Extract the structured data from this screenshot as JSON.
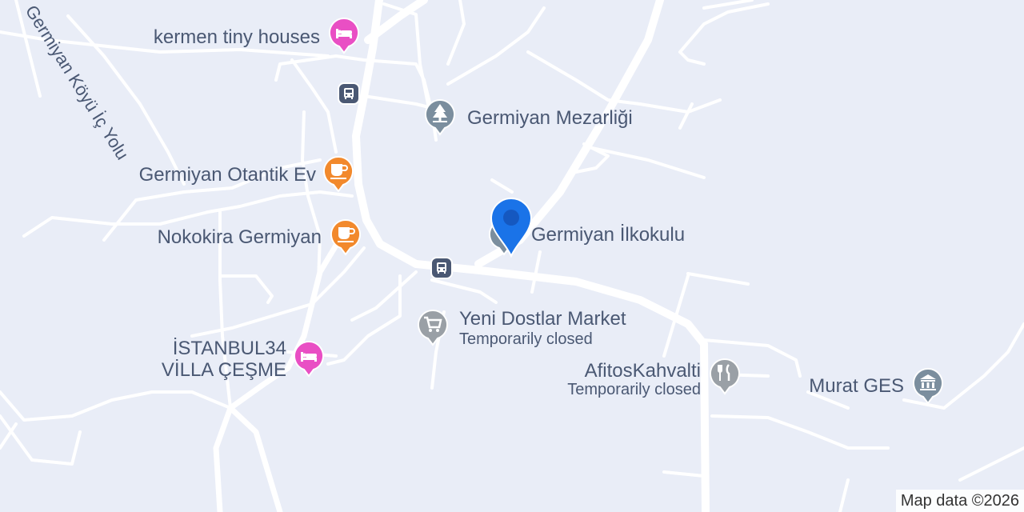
{
  "map": {
    "road_label": "Germiyan Köyü İç Yolu",
    "attribution": "Map data ©2026",
    "colors": {
      "background": "#e9edf7",
      "road": "#ffffff",
      "lodging": "#e94fc4",
      "cafe": "#f2892c",
      "landmark": "#7b8e9e",
      "shop": "#9aa0a6",
      "transit": "#4a5873",
      "pin": "#1a73e8"
    },
    "places": [
      {
        "name": "kermen tiny houses",
        "category": "lodging",
        "icon": "bed-icon"
      },
      {
        "name": "Germiyan Mezarliği",
        "category": "cemetery",
        "icon": "tree-icon"
      },
      {
        "name": "Germiyan Otantik Ev",
        "category": "cafe",
        "icon": "cup-icon"
      },
      {
        "name": "Nokokira Germiyan",
        "category": "cafe",
        "icon": "cup-icon"
      },
      {
        "name": "Germiyan İlkokulu",
        "category": "school",
        "icon": "school-icon"
      },
      {
        "name": "Yeni Dostlar Market",
        "status": "Temporarily closed",
        "category": "shop",
        "icon": "cart-icon"
      },
      {
        "name": "İSTANBUL34",
        "name_line2": "VİLLA ÇEŞME",
        "category": "lodging",
        "icon": "bed-icon"
      },
      {
        "name": "AfitosKahvalti",
        "status": "Temporarily closed",
        "category": "restaurant",
        "icon": "fork-knife-icon"
      },
      {
        "name": "Murat GES",
        "category": "building",
        "icon": "building-icon"
      }
    ],
    "transit": [
      "bus-stop-icon",
      "bus-stop-icon"
    ],
    "selected_marker": "location-pin-icon"
  }
}
